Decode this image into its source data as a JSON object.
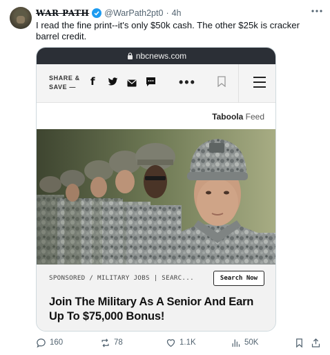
{
  "author": {
    "display_name": "WAR PATH",
    "handle": "@WarPath2pt0",
    "separator": "·",
    "time": "4h"
  },
  "tweet": {
    "text": "I read the fine print--it's only $50k cash. The other $25k is cracker barrel credit."
  },
  "more_icon": "more-horizontal-icon",
  "screenshot": {
    "url": "nbcnews.com",
    "share_line1": "SHARE &",
    "share_line2": "SAVE —",
    "social_icons": [
      "facebook-icon",
      "twitter-icon",
      "email-icon",
      "comment-icon"
    ],
    "more_dots": "•••",
    "taboola_brand": "Taboola",
    "taboola_feed": " Feed",
    "sponsored_text": "SPONSORED / MILITARY JOBS | SEARC...",
    "search_button": "Search Now",
    "ad_title": "Join The Military As A Senior And Earn Up To $75,000 Bonus!"
  },
  "actions": {
    "replies": "160",
    "reposts": "78",
    "likes": "1.1K",
    "views": "50K"
  },
  "colors": {
    "verified": "#1d9bf0",
    "muted": "#536471",
    "url_bar": "#2b2f36"
  }
}
